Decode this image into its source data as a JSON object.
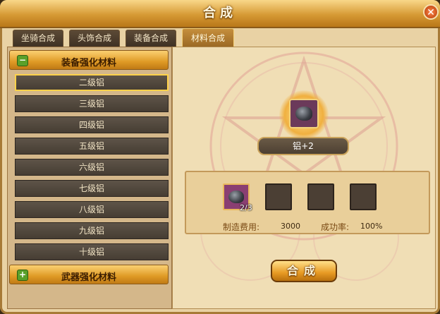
{
  "window": {
    "title": "合成",
    "close_label": "✕"
  },
  "tabs": [
    {
      "label": "坐骑合成"
    },
    {
      "label": "头饰合成"
    },
    {
      "label": "装备合成"
    },
    {
      "label": "材料合成"
    }
  ],
  "active_tab": "材料合成",
  "categories": [
    {
      "label": "装备强化材料",
      "toggle": "−",
      "expanded": true,
      "items": [
        {
          "label": "二级铝"
        },
        {
          "label": "三级铝"
        },
        {
          "label": "四级铝"
        },
        {
          "label": "五级铝"
        },
        {
          "label": "六级铝"
        },
        {
          "label": "七级铝"
        },
        {
          "label": "八级铝"
        },
        {
          "label": "九级铝"
        },
        {
          "label": "十级铝"
        }
      ]
    },
    {
      "label": "武器强化材料",
      "toggle": "+",
      "expanded": false
    }
  ],
  "selected_item": "二级铝",
  "result": {
    "name": "铝+2",
    "icon": "aluminum-ore-icon"
  },
  "materials": {
    "slots": [
      {
        "icon": "aluminum-ore-icon",
        "count": "2/3"
      },
      {
        "icon": null
      },
      {
        "icon": null
      },
      {
        "icon": null
      }
    ],
    "cost_label": "制造费用:",
    "cost_value": "3000",
    "success_label": "成功率:",
    "success_value": "100%"
  },
  "craft_button": {
    "label": "合成"
  },
  "colors": {
    "accent": "#e0a030",
    "panel": "#f0deb5",
    "slot_dark": "#4b3f34"
  }
}
